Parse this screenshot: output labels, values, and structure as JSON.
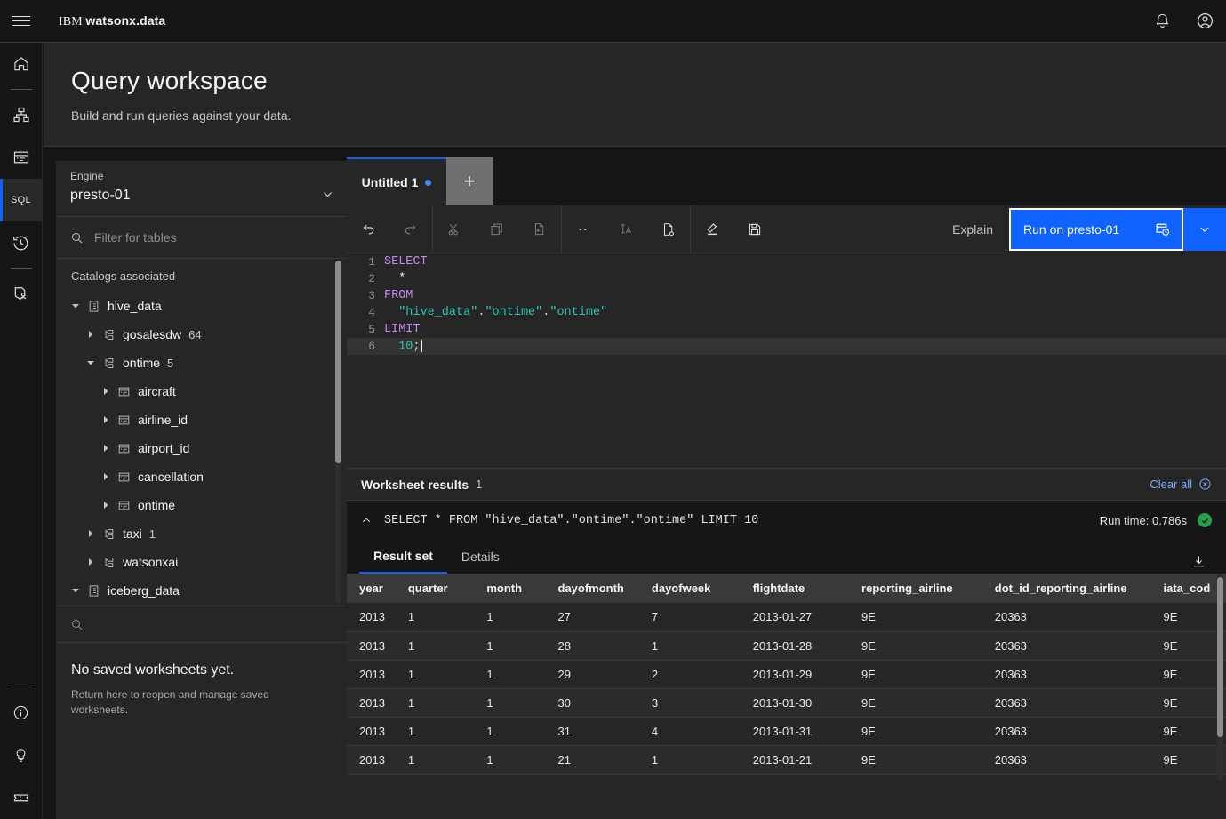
{
  "header": {
    "menu_icon": "hamburger-icon",
    "brand_prefix": "IBM",
    "brand_name": "watsonx.data",
    "notifications_icon": "bell-icon",
    "account_icon": "user-avatar-icon"
  },
  "rail": {
    "items": [
      {
        "name": "home",
        "icon": "home-icon",
        "label": ""
      },
      {
        "name": "infrastructure",
        "icon": "infrastructure-icon",
        "label": ""
      },
      {
        "name": "data-manager",
        "icon": "data-manager-icon",
        "label": ""
      },
      {
        "name": "sql-query-workspace",
        "icon": "sql-icon",
        "label": "SQL",
        "active": true
      },
      {
        "name": "query-history",
        "icon": "history-icon",
        "label": ""
      },
      {
        "name": "access-control",
        "icon": "access-control-icon",
        "label": ""
      }
    ],
    "bottom_items": [
      {
        "name": "about",
        "icon": "information-icon"
      },
      {
        "name": "tips",
        "icon": "lightbulb-icon"
      },
      {
        "name": "support",
        "icon": "ticket-icon"
      }
    ]
  },
  "page": {
    "title": "Query workspace",
    "subtitle": "Build and run queries against your data."
  },
  "left_panel": {
    "engine_label": "Engine",
    "engine_value": "presto-01",
    "engine_chevron_icon": "chevron-down-icon",
    "filter_placeholder": "Filter for tables",
    "filter_value": "",
    "search_icon": "search-icon",
    "catalogs_caption": "Catalogs associated",
    "tree": [
      {
        "label": "hive_data",
        "count": "",
        "level": 0,
        "icon": "catalog-icon",
        "expanded": true
      },
      {
        "label": "gosalesdw",
        "count": "64",
        "level": 1,
        "icon": "schema-icon",
        "expanded": false
      },
      {
        "label": "ontime",
        "count": "5",
        "level": 1,
        "icon": "schema-icon",
        "expanded": true
      },
      {
        "label": "aircraft",
        "count": "",
        "level": 2,
        "icon": "table-icon",
        "expanded": false
      },
      {
        "label": "airline_id",
        "count": "",
        "level": 2,
        "icon": "table-icon",
        "expanded": false
      },
      {
        "label": "airport_id",
        "count": "",
        "level": 2,
        "icon": "table-icon",
        "expanded": false
      },
      {
        "label": "cancellation",
        "count": "",
        "level": 2,
        "icon": "table-icon",
        "expanded": false
      },
      {
        "label": "ontime",
        "count": "",
        "level": 2,
        "icon": "table-icon",
        "expanded": false
      },
      {
        "label": "taxi",
        "count": "1",
        "level": 1,
        "icon": "schema-icon",
        "expanded": false
      },
      {
        "label": "watsonxai",
        "count": "",
        "level": 1,
        "icon": "schema-icon",
        "expanded": false
      },
      {
        "label": "iceberg_data",
        "count": "",
        "level": 0,
        "icon": "catalog-icon",
        "expanded": true
      }
    ],
    "worksheets_search_placeholder": "",
    "worksheets_empty_title": "No saved worksheets yet.",
    "worksheets_empty_sub": "Return here to reopen and manage saved worksheets."
  },
  "editor": {
    "tabs": [
      {
        "label": "Untitled 1",
        "unsaved": true,
        "active": true
      }
    ],
    "add_tab_label": "+",
    "toolbar": [
      {
        "name": "undo-button",
        "icon": "undo-icon",
        "disabled": false
      },
      {
        "name": "redo-button",
        "icon": "redo-icon",
        "disabled": true
      },
      {
        "name": "cut-button",
        "icon": "scissors-icon",
        "disabled": true
      },
      {
        "name": "copy-button",
        "icon": "copy-icon",
        "disabled": true
      },
      {
        "name": "paste-button",
        "icon": "paste-icon",
        "disabled": true
      },
      {
        "name": "comment-button",
        "icon": "comment-dashes-icon",
        "disabled": false
      },
      {
        "name": "format-button",
        "icon": "text-format-icon",
        "disabled": true
      },
      {
        "name": "code-snippet-button",
        "icon": "document-code-icon",
        "disabled": false
      },
      {
        "name": "clear-editor-button",
        "icon": "eraser-icon",
        "disabled": false
      },
      {
        "name": "save-button",
        "icon": "save-icon",
        "disabled": false
      }
    ],
    "explain_label": "Explain",
    "run_label": "Run on presto-01",
    "run_icon": "run-query-icon",
    "run_dropdown_icon": "chevron-down-icon",
    "code_lines": [
      {
        "n": "1",
        "tokens": [
          {
            "t": "SELECT",
            "c": "kw"
          }
        ]
      },
      {
        "n": "2",
        "tokens": [
          {
            "t": "  *",
            "c": "pl"
          }
        ]
      },
      {
        "n": "3",
        "tokens": [
          {
            "t": "FROM",
            "c": "kw"
          }
        ]
      },
      {
        "n": "4",
        "tokens": [
          {
            "t": "  ",
            "c": "pl"
          },
          {
            "t": "\"hive_data\"",
            "c": "str"
          },
          {
            "t": ".",
            "c": "op"
          },
          {
            "t": "\"ontime\"",
            "c": "str"
          },
          {
            "t": ".",
            "c": "op"
          },
          {
            "t": "\"ontime\"",
            "c": "str"
          }
        ]
      },
      {
        "n": "5",
        "tokens": [
          {
            "t": "LIMIT",
            "c": "kw"
          }
        ]
      },
      {
        "n": "6",
        "current": true,
        "tokens": [
          {
            "t": "  ",
            "c": "pl"
          },
          {
            "t": "10",
            "c": "num"
          },
          {
            "t": ";",
            "c": "op"
          }
        ]
      }
    ]
  },
  "results": {
    "title": "Worksheet results",
    "count": "1",
    "clear_all_label": "Clear all",
    "clear_all_icon": "close-filled-icon",
    "collapse_icon": "chevron-up-icon",
    "query_text": "SELECT * FROM \"hive_data\".\"ontime\".\"ontime\" LIMIT 10",
    "run_time_label": "Run time: 0.786s",
    "status_icon": "checkmark-filled-icon",
    "tabs": [
      {
        "label": "Result set",
        "active": true
      },
      {
        "label": "Details",
        "active": false
      }
    ],
    "download_icon": "download-icon",
    "columns": [
      "year",
      "quarter",
      "month",
      "dayofmonth",
      "dayofweek",
      "flightdate",
      "reporting_airline",
      "dot_id_reporting_airline",
      "iata_cod"
    ],
    "rows": [
      [
        "2013",
        "1",
        "1",
        "27",
        "7",
        "2013-01-27",
        "9E",
        "20363",
        "9E"
      ],
      [
        "2013",
        "1",
        "1",
        "28",
        "1",
        "2013-01-28",
        "9E",
        "20363",
        "9E"
      ],
      [
        "2013",
        "1",
        "1",
        "29",
        "2",
        "2013-01-29",
        "9E",
        "20363",
        "9E"
      ],
      [
        "2013",
        "1",
        "1",
        "30",
        "3",
        "2013-01-30",
        "9E",
        "20363",
        "9E"
      ],
      [
        "2013",
        "1",
        "1",
        "31",
        "4",
        "2013-01-31",
        "9E",
        "20363",
        "9E"
      ],
      [
        "2013",
        "1",
        "1",
        "21",
        "1",
        "2013-01-21",
        "9E",
        "20363",
        "9E"
      ]
    ]
  },
  "colors": {
    "accent": "#0f62fe",
    "link": "#78a9ff",
    "success": "#24a148",
    "bg": "#161616",
    "panel": "#262626"
  }
}
